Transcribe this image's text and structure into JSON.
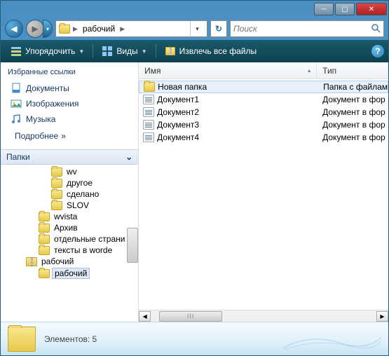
{
  "titlebar": {
    "min": "─",
    "max": "▢",
    "close": "✕"
  },
  "nav": {
    "back": "◀",
    "fwd": "▶",
    "dd": "▾",
    "crumb1": "рабочий",
    "refresh": "↻"
  },
  "search": {
    "placeholder": "Поиск"
  },
  "toolbar": {
    "organize": "Упорядочить",
    "views": "Виды",
    "extract": "Извлечь все файлы",
    "help": "?"
  },
  "fav": {
    "header": "Избранные ссылки",
    "items": [
      {
        "label": "Документы",
        "icon": "doc"
      },
      {
        "label": "Изображения",
        "icon": "pic"
      },
      {
        "label": "Музыка",
        "icon": "music"
      }
    ],
    "more": "Подробнее",
    "more_arrow": "»"
  },
  "folders": {
    "header": "Папки",
    "chev": "⌄",
    "tree": [
      {
        "indent": 4,
        "label": "wv"
      },
      {
        "indent": 4,
        "label": "другое"
      },
      {
        "indent": 4,
        "label": "сделано"
      },
      {
        "indent": 4,
        "label": "SLOV"
      },
      {
        "indent": 3,
        "label": "wvista"
      },
      {
        "indent": 3,
        "label": "Архив"
      },
      {
        "indent": 3,
        "label": "отдельные страни"
      },
      {
        "indent": 3,
        "label": "тексты в worde"
      },
      {
        "indent": 2,
        "label": "рабочий",
        "zip": true
      },
      {
        "indent": 3,
        "label": "рабочий",
        "selected": true
      }
    ]
  },
  "cols": {
    "name": "Имя",
    "type": "Тип",
    "sort": "▴"
  },
  "files": [
    {
      "name": "Новая папка",
      "type": "Папка с файлам",
      "kind": "folder",
      "selected": true
    },
    {
      "name": "Документ1",
      "type": "Документ в фор",
      "kind": "doc"
    },
    {
      "name": "Документ2",
      "type": "Документ в фор",
      "kind": "doc"
    },
    {
      "name": "Документ3",
      "type": "Документ в фор",
      "kind": "doc"
    },
    {
      "name": "Документ4",
      "type": "Документ в фор",
      "kind": "doc"
    }
  ],
  "details": {
    "text": "Элементов: 5"
  }
}
